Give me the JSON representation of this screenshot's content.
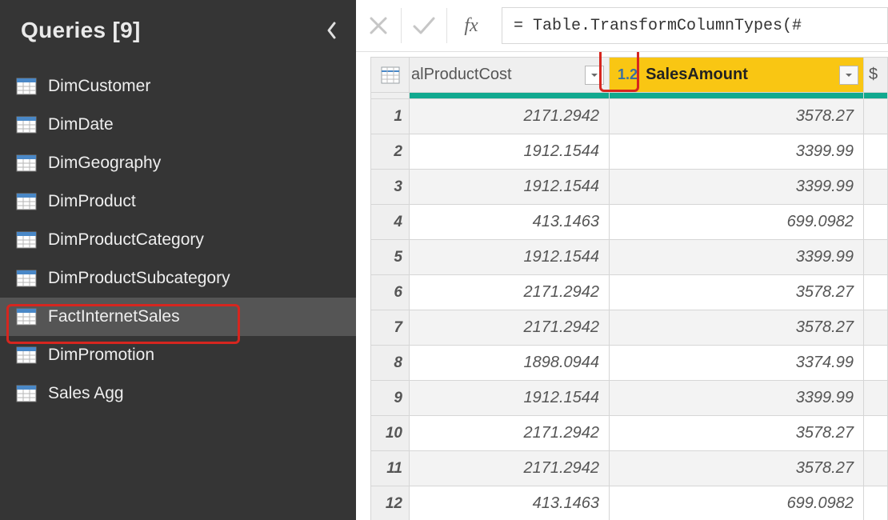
{
  "sidebar": {
    "title": "Queries [9]",
    "items": [
      {
        "label": "DimCustomer",
        "selected": false
      },
      {
        "label": "DimDate",
        "selected": false
      },
      {
        "label": "DimGeography",
        "selected": false
      },
      {
        "label": "DimProduct",
        "selected": false
      },
      {
        "label": "DimProductCategory",
        "selected": false
      },
      {
        "label": "DimProductSubcategory",
        "selected": false
      },
      {
        "label": "FactInternetSales",
        "selected": true
      },
      {
        "label": "DimPromotion",
        "selected": false
      },
      {
        "label": "Sales Agg",
        "selected": false
      }
    ]
  },
  "formula_bar": {
    "fx_label": "fx",
    "formula": "= Table.TransformColumnTypes(#"
  },
  "columns": {
    "cost": {
      "label": "alProductCost",
      "type_badge": ""
    },
    "sales": {
      "label": "SalesAmount",
      "type_badge": "1.2"
    },
    "extra": {
      "label": "$"
    }
  },
  "rows": [
    {
      "n": "1",
      "cost": "2171.2942",
      "sales": "3578.27"
    },
    {
      "n": "2",
      "cost": "1912.1544",
      "sales": "3399.99"
    },
    {
      "n": "3",
      "cost": "1912.1544",
      "sales": "3399.99"
    },
    {
      "n": "4",
      "cost": "413.1463",
      "sales": "699.0982"
    },
    {
      "n": "5",
      "cost": "1912.1544",
      "sales": "3399.99"
    },
    {
      "n": "6",
      "cost": "2171.2942",
      "sales": "3578.27"
    },
    {
      "n": "7",
      "cost": "2171.2942",
      "sales": "3578.27"
    },
    {
      "n": "8",
      "cost": "1898.0944",
      "sales": "3374.99"
    },
    {
      "n": "9",
      "cost": "1912.1544",
      "sales": "3399.99"
    },
    {
      "n": "10",
      "cost": "2171.2942",
      "sales": "3578.27"
    },
    {
      "n": "11",
      "cost": "2171.2942",
      "sales": "3578.27"
    },
    {
      "n": "12",
      "cost": "413.1463",
      "sales": "699.0982"
    }
  ]
}
